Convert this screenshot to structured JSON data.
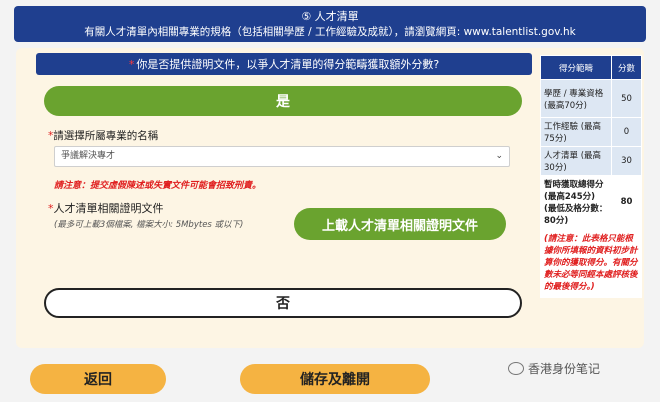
{
  "header": {
    "step": "⑤ 人才清單",
    "description": "有關人才清單內相關專業的規格（包括相關學歷 / 工作經驗及成就），請瀏覽網頁: www.talentlist.gov.hk"
  },
  "question": {
    "star": "*",
    "text": "你是否提供證明文件，以爭人才清單的得分範疇獲取額外分數?"
  },
  "yes_label": "是",
  "profession": {
    "star": "*",
    "label": "請選擇所屬專業的名稱",
    "selected": "爭議解決專才"
  },
  "notice": "請注意：提交虛假陳述或失實文件可能會招致刑責。",
  "upload": {
    "star": "*",
    "label": "人才清單相關證明文件",
    "hint": "(最多可上載3個檔案, 檔案大小: 5Mbytes 或以下)",
    "button": "上載人才清單相關證明文件"
  },
  "no_label": "否",
  "score_table": {
    "col_category": "得分範疇",
    "col_score": "分數",
    "rows": [
      {
        "label": "學歷 / 專業資格 (最高70分)",
        "score": "50"
      },
      {
        "label": "工作經驗 (最高75分)",
        "score": "0"
      },
      {
        "label": "人才清單 (最高30分)",
        "score": "30"
      }
    ],
    "total_label": "暫時獲取總得分 (最高245分) (最低及格分數：80分)",
    "total_score": "80",
    "note": "(請注意：此表格只能根據你所填報的資料初步計算你的獲取得分。有關分數未必等同經本處評核後的最後得分。)"
  },
  "back_label": "返回",
  "save_label": "儲存及離開",
  "watermark": "香港身份笔记"
}
